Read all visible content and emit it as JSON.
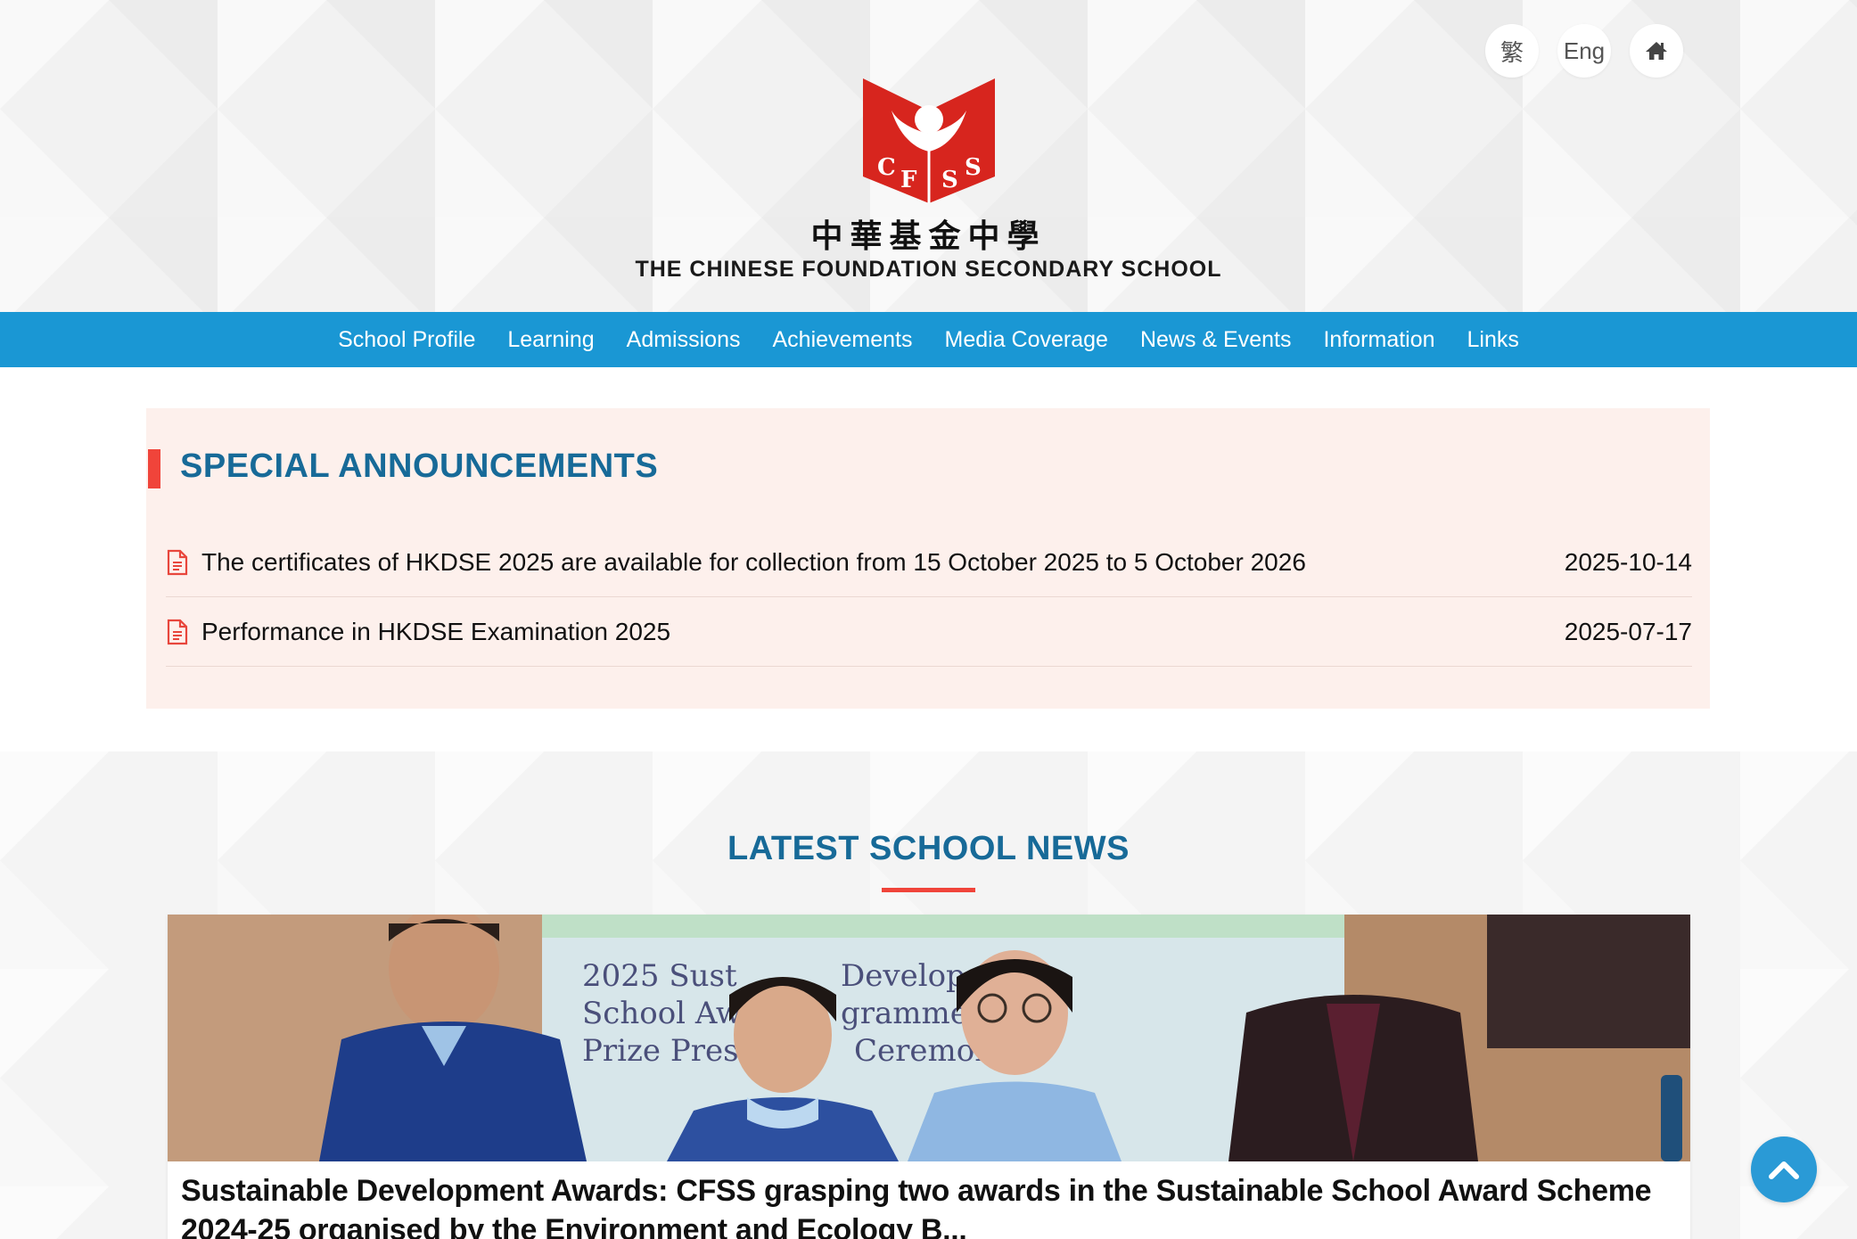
{
  "header": {
    "lang_trad": "繁",
    "lang_eng": "Eng",
    "logo_letters": [
      "C",
      "F",
      "S",
      "S"
    ],
    "school_name_cn": "中華基金中學",
    "school_name_en": "THE CHINESE FOUNDATION SECONDARY SCHOOL"
  },
  "nav": {
    "items": [
      "School Profile",
      "Learning",
      "Admissions",
      "Achievements",
      "Media Coverage",
      "News & Events",
      "Information",
      "Links"
    ]
  },
  "announcements": {
    "title": "SPECIAL ANNOUNCEMENTS",
    "items": [
      {
        "text": "The certificates of HKDSE 2025 are available for collection from 15 October 2025 to 5 October 2026",
        "date": "2025-10-14"
      },
      {
        "text": "Performance in HKDSE Examination 2025",
        "date": "2025-07-17"
      }
    ]
  },
  "news": {
    "title": "LATEST SCHOOL NEWS",
    "photo_banner_lines": [
      "2025 Sust",
      "Develop",
      "School Aw",
      "gramme",
      "Prize Prese",
      "Ceremon"
    ],
    "headline": "Sustainable Development Awards: CFSS grasping two awards in the Sustainable School Award Scheme 2024-25 organised by the Environment and Ecology B..."
  },
  "colors": {
    "nav_blue": "#1a97d4",
    "heading_blue": "#176a98",
    "accent_red": "#f0443a",
    "announcement_bg": "#fdf0ec"
  },
  "icons": {
    "home": "home-icon",
    "document": "document-icon",
    "back_to_top": "chevron-up-icon"
  }
}
